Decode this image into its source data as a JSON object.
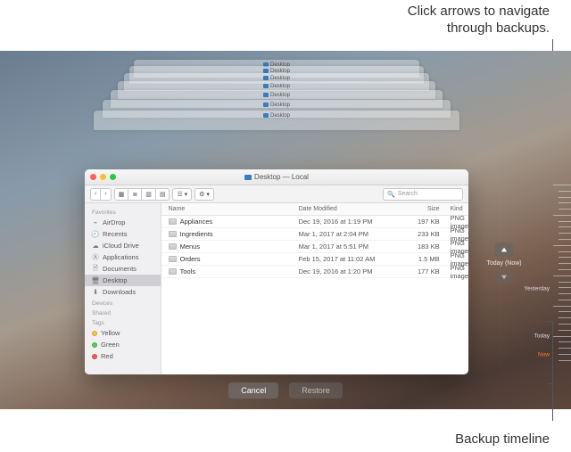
{
  "annotations": {
    "top_line1": "Click arrows to navigate",
    "top_line2": "through backups.",
    "bottom": "Backup timeline"
  },
  "window": {
    "title": "Desktop — Local",
    "search_placeholder": "Search"
  },
  "traffic": {
    "close": "#ff5f57",
    "min": "#febc2e",
    "max": "#28c840"
  },
  "columns": {
    "name": "Name",
    "date": "Date Modified",
    "size": "Size",
    "kind": "Kind"
  },
  "sidebar": {
    "favorites_head": "Favorites",
    "devices_head": "Devices",
    "shared_head": "Shared",
    "tags_head": "Tags",
    "items": [
      {
        "label": "AirDrop"
      },
      {
        "label": "Recents"
      },
      {
        "label": "iCloud Drive"
      },
      {
        "label": "Applications"
      },
      {
        "label": "Documents"
      },
      {
        "label": "Desktop",
        "selected": true
      },
      {
        "label": "Downloads"
      }
    ],
    "tags": [
      {
        "label": "Yellow",
        "color": "#f6c344"
      },
      {
        "label": "Green",
        "color": "#63c657"
      },
      {
        "label": "Red",
        "color": "#f15b52"
      }
    ]
  },
  "files": [
    {
      "name": "Appliances",
      "date": "Dec 19, 2016 at 1:19 PM",
      "size": "197 KB",
      "kind": "PNG image"
    },
    {
      "name": "Ingredients",
      "date": "Mar 1, 2017 at 2:04 PM",
      "size": "233 KB",
      "kind": "PNG image"
    },
    {
      "name": "Menus",
      "date": "Mar 1, 2017 at 5:51 PM",
      "size": "183 KB",
      "kind": "PNG image"
    },
    {
      "name": "Orders",
      "date": "Feb 15, 2017 at 11:02 AM",
      "size": "1.5 MB",
      "kind": "PNG image"
    },
    {
      "name": "Tools",
      "date": "Dec 19, 2016 at 1:20 PM",
      "size": "177 KB",
      "kind": "PNG image"
    }
  ],
  "nav": {
    "today_label": "Today (Now)"
  },
  "timeline": {
    "yesterday": "Yesterday",
    "today": "Today",
    "now": "Now"
  },
  "buttons": {
    "cancel": "Cancel",
    "restore": "Restore"
  }
}
